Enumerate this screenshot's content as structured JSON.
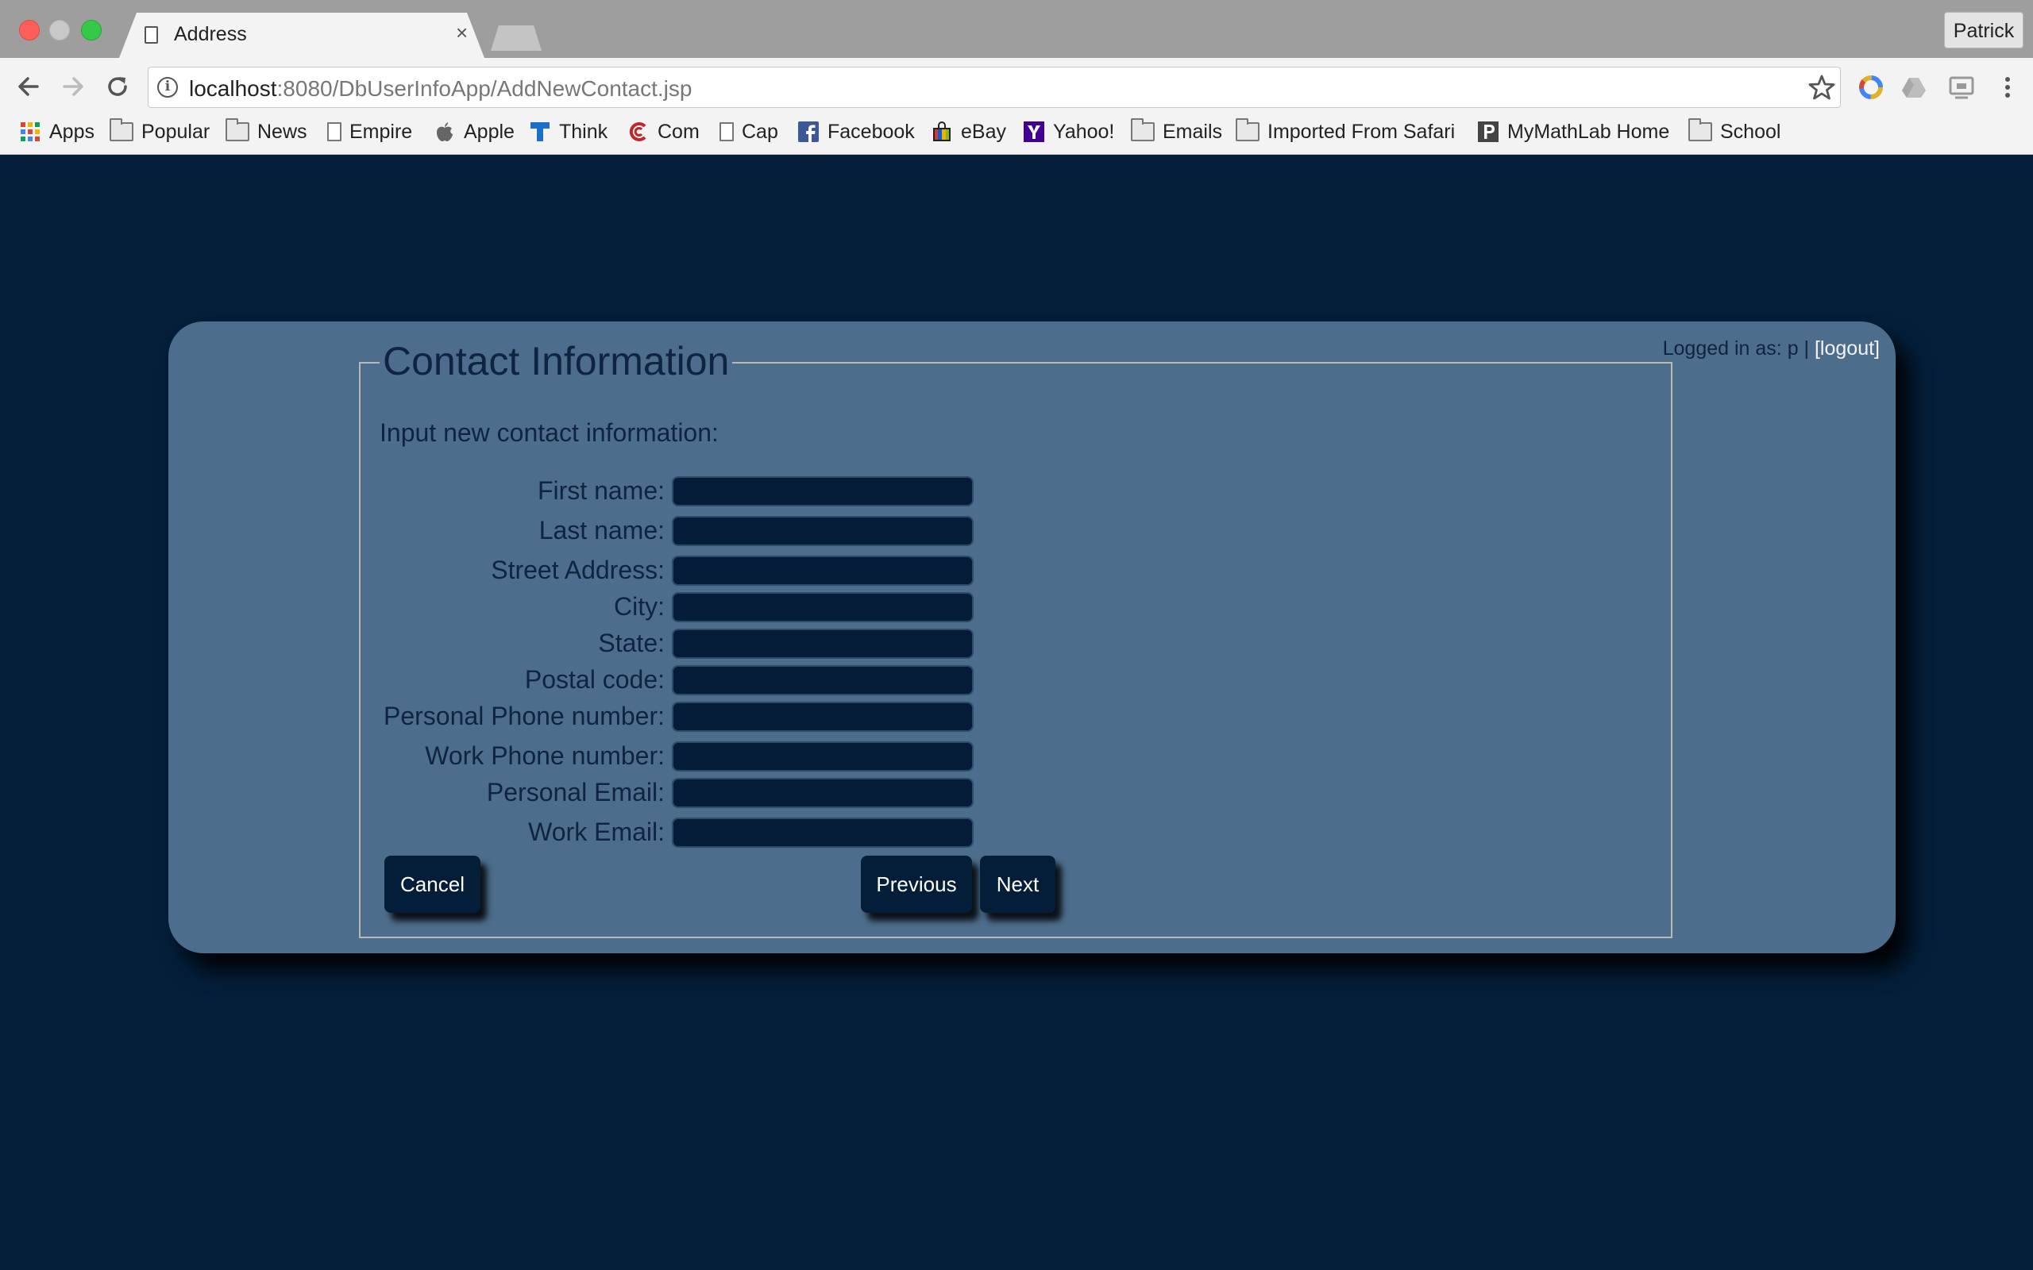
{
  "browser": {
    "tab_title": "Address",
    "tab_close": "×",
    "profile_name": "Patrick",
    "url_host": "localhost",
    "url_rest": ":8080/DbUserInfoApp/AddNewContact.jsp",
    "bookmarks": [
      {
        "label": "Apps",
        "icon": "apps-grid-icon"
      },
      {
        "label": "Popular",
        "icon": "folder-icon"
      },
      {
        "label": "News",
        "icon": "folder-icon"
      },
      {
        "label": "Empire",
        "icon": "page-icon"
      },
      {
        "label": "Apple",
        "icon": "apple-icon"
      },
      {
        "label": "Think",
        "icon": "think-icon"
      },
      {
        "label": "Com",
        "icon": "com-icon"
      },
      {
        "label": "Cap",
        "icon": "page-icon"
      },
      {
        "label": "Facebook",
        "icon": "facebook-icon"
      },
      {
        "label": "eBay",
        "icon": "ebay-icon"
      },
      {
        "label": "Yahoo!",
        "icon": "yahoo-icon"
      },
      {
        "label": "Emails",
        "icon": "folder-icon"
      },
      {
        "label": "Imported From Safari",
        "icon": "folder-icon"
      },
      {
        "label": "MyMathLab Home",
        "icon": "mymathlab-icon"
      },
      {
        "label": "School",
        "icon": "folder-icon"
      }
    ]
  },
  "page": {
    "legend": "Contact Information",
    "login_prefix": "Logged in as: p | ",
    "logout_label": "[logout]",
    "intro": "Input new contact information:",
    "fields": [
      {
        "label": "First name:",
        "value": ""
      },
      {
        "label": "Last name:",
        "value": ""
      },
      {
        "label": "Street Address:",
        "value": ""
      },
      {
        "label": "City:",
        "value": ""
      },
      {
        "label": "State:",
        "value": ""
      },
      {
        "label": "Postal code:",
        "value": ""
      },
      {
        "label": "Personal Phone number:",
        "value": ""
      },
      {
        "label": "Work Phone number:",
        "value": ""
      },
      {
        "label": "Personal Email:",
        "value": ""
      },
      {
        "label": "Work Email:",
        "value": ""
      }
    ],
    "buttons": {
      "cancel": "Cancel",
      "previous": "Previous",
      "next": "Next"
    }
  },
  "colors": {
    "page_background": "#041e3a",
    "panel_background": "#4d6d8c",
    "text_dark": "#0e2440",
    "input_background": "#051c38"
  }
}
